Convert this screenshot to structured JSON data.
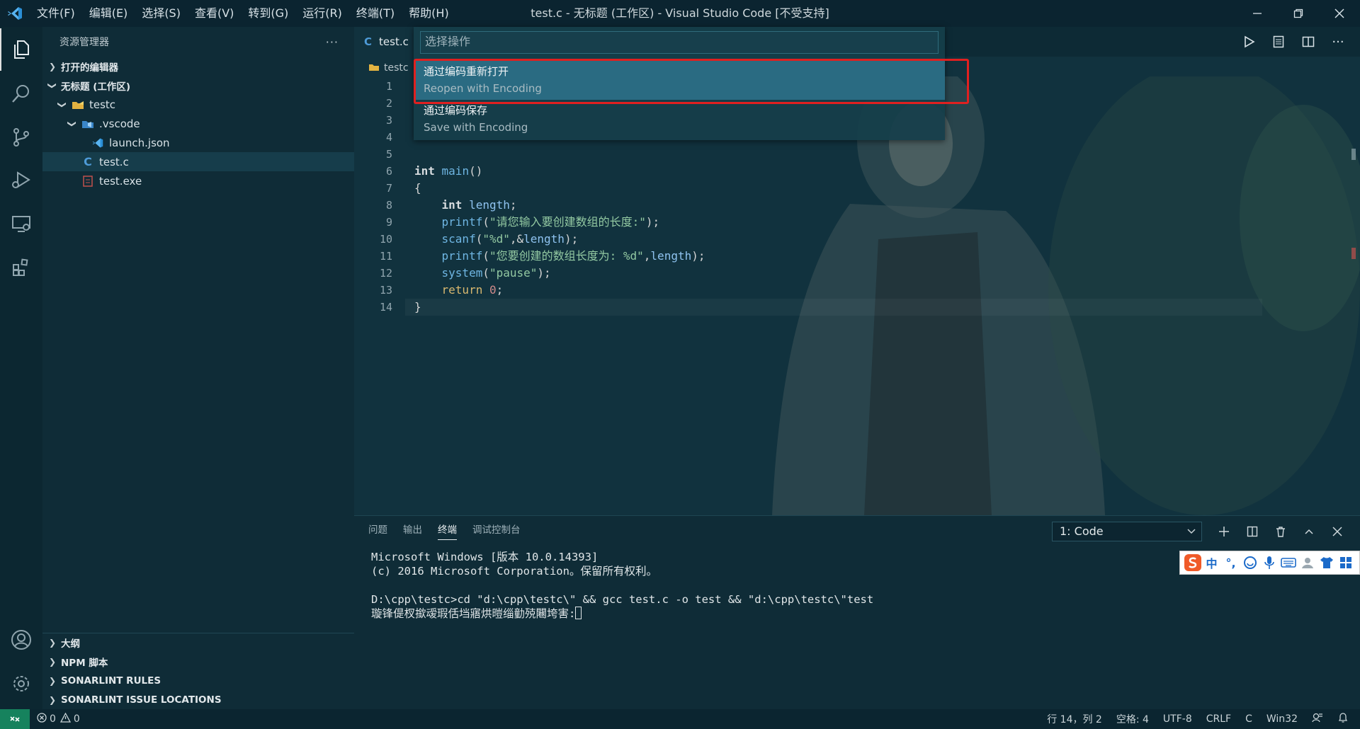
{
  "titlebar": {
    "menu": [
      "文件(F)",
      "编辑(E)",
      "选择(S)",
      "查看(V)",
      "转到(G)",
      "运行(R)",
      "终端(T)",
      "帮助(H)"
    ],
    "title": "test.c - 无标题 (工作区) - Visual Studio Code [不受支持]"
  },
  "sidebar": {
    "title": "资源管理器",
    "more": "···",
    "open_editors": "打开的编辑器",
    "workspace": "无标题 (工作区)",
    "tree": {
      "folder": "testc",
      "vscode_folder": ".vscode",
      "launch": "launch.json",
      "testc_file": "test.c",
      "testexe": "test.exe"
    },
    "bottom_sections": [
      "大纲",
      "NPM 脚本",
      "SONARLINT RULES",
      "SONARLINT ISSUE LOCATIONS"
    ]
  },
  "editor": {
    "tab_label": "test.c",
    "breadcrumb": "testc",
    "line_numbers": [
      "1",
      "2",
      "3",
      "4",
      "5",
      "6",
      "7",
      "8",
      "9",
      "10",
      "11",
      "12",
      "13",
      "14"
    ],
    "code": {
      "l6_kw": "int",
      "l6_fn": " main",
      "l6_rest": "()",
      "l7": "{",
      "l8_indent": "    ",
      "l8_kw": "int",
      "l8_var": " length",
      "l8_rest": ";",
      "l9_fn": "printf",
      "l9_p1": "(",
      "l9_str": "\"请您输入要创建数组的长度:\"",
      "l9_p2": ");",
      "l10_fn": "scanf",
      "l10_p1": "(",
      "l10_str": "\"%d\"",
      "l10_p2": ",&",
      "l10_var": "length",
      "l10_p3": ");",
      "l11_fn": "printf",
      "l11_p1": "(",
      "l11_str": "\"您要创建的数组长度为: %d\"",
      "l11_p2": ",",
      "l11_var": "length",
      "l11_p3": ");",
      "l12_fn": "system",
      "l12_p1": "(",
      "l12_str": "\"pause\"",
      "l12_p2": ");",
      "l13_kw": "return",
      "l13_num": " 0",
      "l13_p": ";",
      "l14": "}"
    }
  },
  "quickpick": {
    "placeholder": "选择操作",
    "items": [
      {
        "label": "通过编码重新打开",
        "description": "Reopen with Encoding"
      },
      {
        "label": "通过编码保存",
        "description": "Save with Encoding"
      }
    ]
  },
  "panel": {
    "tabs": [
      "问题",
      "输出",
      "终端",
      "调试控制台"
    ],
    "active_tab": "终端",
    "terminal_select": "1: Code",
    "terminal_lines": [
      "Microsoft Windows [版本 10.0.14393]",
      "(c) 2016 Microsoft Corporation。保留所有权利。",
      "",
      "D:\\cpp\\testc>cd \"d:\\cpp\\testc\\\" && gcc test.c -o test && \"d:\\cpp\\testc\\\"test",
      "璇锋偍杈撳叆瑕佸垱寤烘暟缁勭殑闀垮害:"
    ]
  },
  "ime": {
    "chinese": "中",
    "punct": "°,"
  },
  "statusbar": {
    "errors": "0",
    "warnings": "0",
    "position": "行 14，列 2",
    "spaces": "空格: 4",
    "encoding": "UTF-8",
    "eol": "CRLF",
    "language": "C",
    "platform": "Win32"
  },
  "colors": {
    "accent_highlight": "#e02020",
    "selection": "#2a6b82",
    "remote": "#16825d"
  }
}
